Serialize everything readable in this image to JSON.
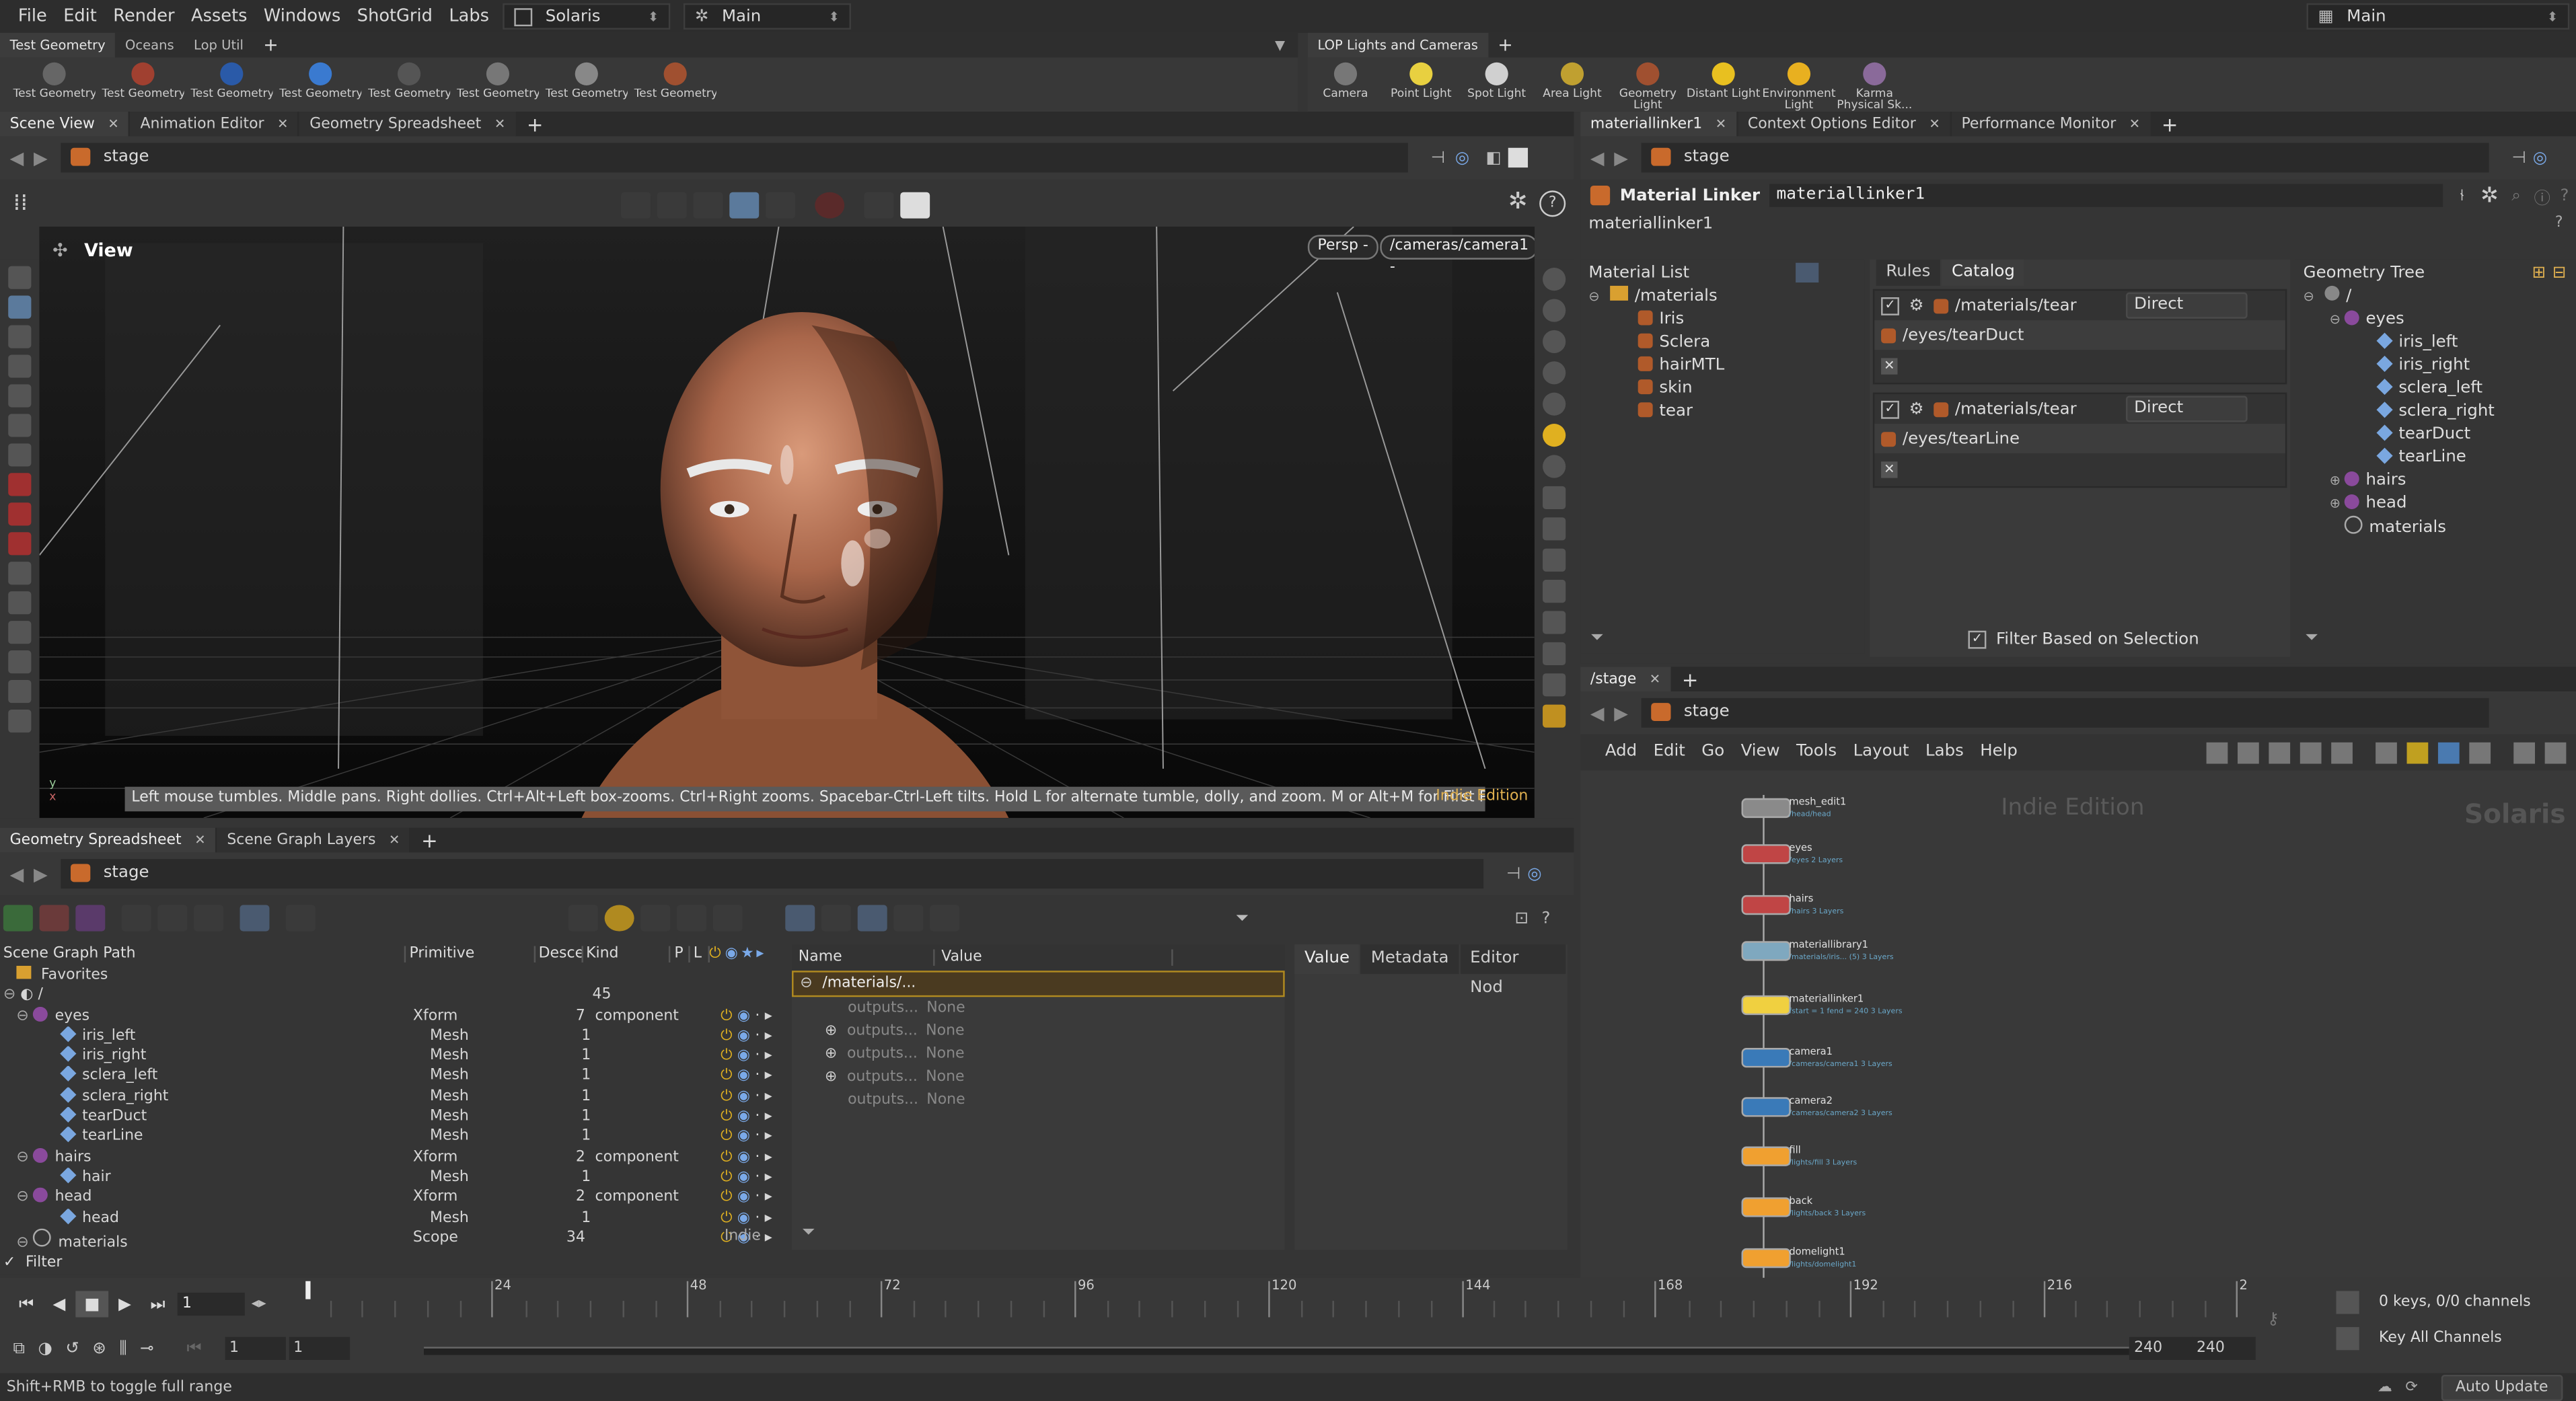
{
  "menubar": {
    "items": [
      "File",
      "Edit",
      "Render",
      "Assets",
      "Windows",
      "ShotGrid",
      "Labs",
      "Help"
    ],
    "desktop": "Solaris",
    "context": "Main",
    "desktop_right": "Main"
  },
  "left_shelf": {
    "tabs": [
      "Test Geometry",
      "Oceans",
      "Lop Util"
    ],
    "tools": [
      "Test Geometry:...",
      "Test Geometry:...",
      "Test Geometry:...",
      "Test Geometry:...",
      "Test Geometry:...",
      "Test Geometry:...",
      "Test Geometry:...",
      "Test Geometry:..."
    ]
  },
  "right_shelf": {
    "tabs": [
      "LOP Lights and Cameras"
    ],
    "tools": [
      "Camera",
      "Point Light",
      "Spot Light",
      "Area Light",
      "Geometry Light",
      "Distant Light",
      "Environment Light",
      "Karma Physical Sk..."
    ]
  },
  "scene_pane": {
    "tabs": [
      "Scene View",
      "Animation Editor",
      "Geometry Spreadsheet"
    ],
    "path": "stage",
    "view_label": "View",
    "persp": "Persp -",
    "camera": "/cameras/camera1 -",
    "hint": "Left mouse tumbles. Middle pans. Right dollies. Ctrl+Alt+Left box-zooms. Ctrl+Right zooms. Spacebar-Ctrl-Left tilts. Hold L for alternate tumble, dolly, and zoom.   M or Alt+M for First Person Navigation.",
    "watermark": "Indie Edition"
  },
  "param_pane": {
    "tabs": [
      "materiallinker1",
      "Context Options Editor",
      "Performance Monitor"
    ],
    "path": "stage",
    "node_type": "Material Linker",
    "node_name": "materiallinker1",
    "node_path": "materiallinker1",
    "material_list_label": "Material List",
    "materials_root": "/materials",
    "materials": [
      "Iris",
      "Sclera",
      "hairMTL",
      "skin",
      "tear"
    ],
    "rule_tabs": [
      "Rules",
      "Catalog"
    ],
    "rules": [
      {
        "material": "/materials/tear",
        "mode": "Direct",
        "target": "/eyes/tearDuct"
      },
      {
        "material": "/materials/tear",
        "mode": "Direct",
        "target": "/eyes/tearLine"
      }
    ],
    "filter_label": "Filter Based on Selection",
    "geometry_tree_label": "Geometry Tree",
    "geo_root": "/",
    "geo_tree": [
      {
        "label": "eyes",
        "depth": 1,
        "type": "prim"
      },
      {
        "label": "iris_left",
        "depth": 2,
        "type": "mesh"
      },
      {
        "label": "iris_right",
        "depth": 2,
        "type": "mesh"
      },
      {
        "label": "sclera_left",
        "depth": 2,
        "type": "mesh"
      },
      {
        "label": "sclera_right",
        "depth": 2,
        "type": "mesh"
      },
      {
        "label": "tearDuct",
        "depth": 2,
        "type": "mesh"
      },
      {
        "label": "tearLine",
        "depth": 2,
        "type": "mesh"
      },
      {
        "label": "hairs",
        "depth": 1,
        "type": "prim"
      },
      {
        "label": "head",
        "depth": 1,
        "type": "prim"
      },
      {
        "label": "materials",
        "depth": 1,
        "type": "scope"
      }
    ]
  },
  "network_pane": {
    "tabs": [
      "/stage"
    ],
    "path": "stage",
    "menu": [
      "Add",
      "Edit",
      "Go",
      "View",
      "Tools",
      "Layout",
      "Labs",
      "Help"
    ],
    "watermark": "Indie Edition",
    "context_label": "Solaris",
    "nodes": [
      {
        "name": "mesh_edit1",
        "sub": "/head/head",
        "color": "#8a8a8a"
      },
      {
        "name": "eyes",
        "sub": "/eyes  2 Layers",
        "color": "#c04545"
      },
      {
        "name": "hairs",
        "sub": "/hairs  3 Layers",
        "color": "#c04545"
      },
      {
        "name": "materiallibrary1",
        "sub": "/materials/iris... (5)  3 Layers",
        "color": "#7fa8bf"
      },
      {
        "name": "materiallinker1",
        "sub": "fstart = 1  fend = 240  3 Layers",
        "color": "#f0d040"
      },
      {
        "name": "camera1",
        "sub": "/cameras/camera1  3 Layers",
        "color": "#3a7ab8"
      },
      {
        "name": "camera2",
        "sub": "/cameras/camera2  3 Layers",
        "color": "#3a7ab8"
      },
      {
        "name": "fill",
        "sub": "/lights/fill  3 Layers",
        "color": "#f0a030"
      },
      {
        "name": "back",
        "sub": "/lights/back  3 Layers",
        "color": "#f0a030"
      },
      {
        "name": "domelight1",
        "sub": "/lights/domelight1",
        "color": "#f0a030"
      }
    ]
  },
  "spreadsheet": {
    "tabs": [
      "Geometry Spreadsheet",
      "Scene Graph Layers"
    ],
    "path": "stage",
    "columns": [
      "Scene Graph Path",
      "Primitive",
      "Descenda",
      "Kind",
      "P",
      "L"
    ],
    "favorites": "Favorites",
    "root_count": "45",
    "rows": [
      {
        "name": "eyes",
        "prim": "Xform",
        "count": "7",
        "kind": "component",
        "depth": 1
      },
      {
        "name": "iris_left",
        "prim": "Mesh",
        "count": "1",
        "kind": "",
        "depth": 2
      },
      {
        "name": "iris_right",
        "prim": "Mesh",
        "count": "1",
        "kind": "",
        "depth": 2
      },
      {
        "name": "sclera_left",
        "prim": "Mesh",
        "count": "1",
        "kind": "",
        "depth": 2
      },
      {
        "name": "sclera_right",
        "prim": "Mesh",
        "count": "1",
        "kind": "",
        "depth": 2
      },
      {
        "name": "tearDuct",
        "prim": "Mesh",
        "count": "1",
        "kind": "",
        "depth": 2
      },
      {
        "name": "tearLine",
        "prim": "Mesh",
        "count": "1",
        "kind": "",
        "depth": 2
      },
      {
        "name": "hairs",
        "prim": "Xform",
        "count": "2",
        "kind": "component",
        "depth": 1
      },
      {
        "name": "hair",
        "prim": "Mesh",
        "count": "1",
        "kind": "",
        "depth": 2
      },
      {
        "name": "head",
        "prim": "Xform",
        "count": "2",
        "kind": "component",
        "depth": 1
      },
      {
        "name": "head",
        "prim": "Mesh",
        "count": "1",
        "kind": "",
        "depth": 2
      },
      {
        "name": "materials",
        "prim": "Scope",
        "count": "34",
        "kind": "",
        "depth": 1
      }
    ],
    "filter": "Filter",
    "indie": "Indie",
    "prop_columns": [
      "Name",
      "Value"
    ],
    "prop_root": "/materials/...",
    "props": [
      {
        "name": "outputs...",
        "value": "None"
      },
      {
        "name": "outputs...",
        "value": "None"
      },
      {
        "name": "outputs...",
        "value": "None"
      },
      {
        "name": "outputs...",
        "value": "None"
      },
      {
        "name": "outputs...",
        "value": "None"
      }
    ],
    "detail_tabs": [
      "Value",
      "Metadata",
      "Editor Nod"
    ]
  },
  "timeline": {
    "frame": "1",
    "ticks": [
      "24",
      "48",
      "72",
      "96",
      "120",
      "144",
      "168",
      "192",
      "216",
      "2"
    ],
    "range_start": "1",
    "range_start2": "1",
    "range_end": "240",
    "range_end2": "240",
    "keys_info": "0 keys, 0/0 channels",
    "key_all": "Key All Channels",
    "auto_update": "Auto Update"
  },
  "status": "Shift+RMB to toggle full range"
}
